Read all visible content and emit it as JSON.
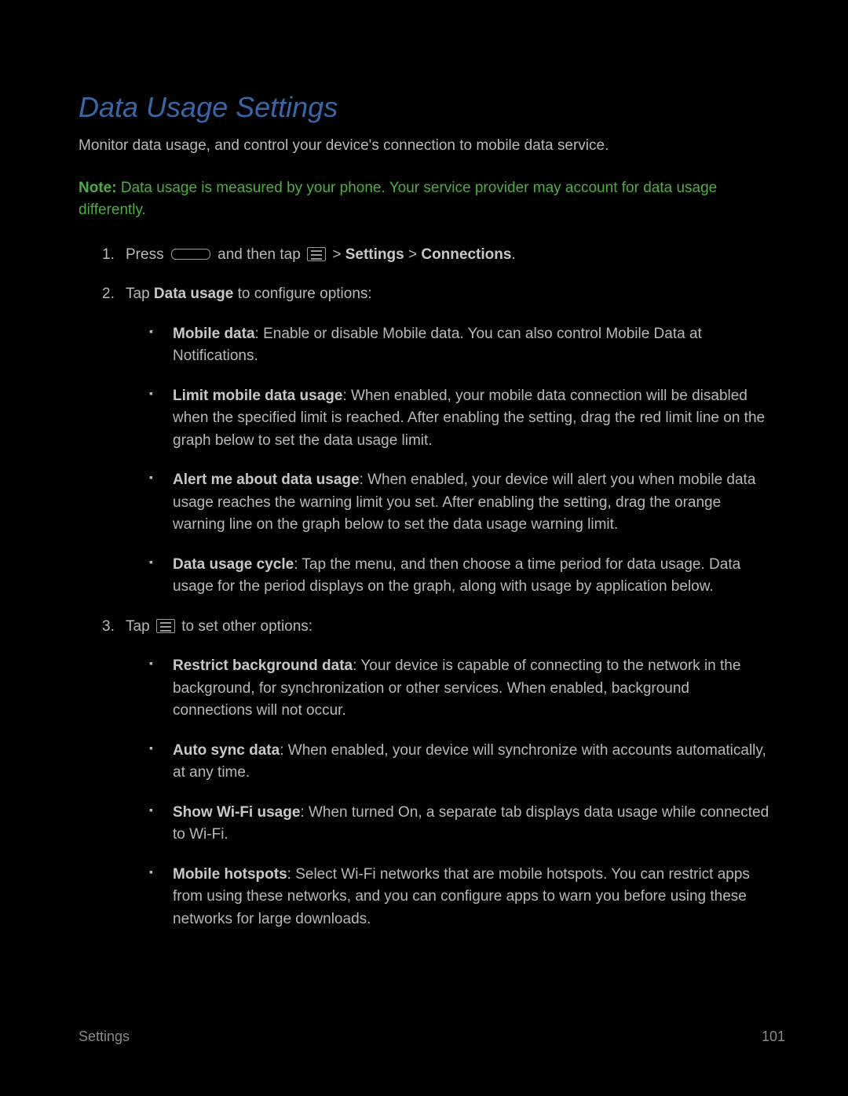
{
  "title": "Data Usage Settings",
  "intro": "Monitor data usage, and control your device's connection to mobile data service.",
  "note_label": "Note:",
  "note_text": " Data usage is measured by your phone. Your service provider may account for data usage differently.",
  "steps": {
    "s1": {
      "before": "Press ",
      "mid": " and then tap ",
      "after1": " > ",
      "bold1": "Settings",
      "sep": " > ",
      "bold2": "Connections",
      "end": "."
    },
    "s2": {
      "before": "Tap ",
      "bold": "Data usage",
      "after": " to configure options:"
    },
    "s3": {
      "before": "Tap ",
      "after": " to set other options:"
    }
  },
  "options1": {
    "b1": {
      "label": "Mobile data",
      "text": ": Enable or disable Mobile data. You can also control Mobile Data at Notifications."
    },
    "b2": {
      "label": "Limit mobile data usage",
      "text": ": When enabled, your mobile data connection will be disabled when the specified limit is reached. After enabling the setting, drag the red limit line on the graph below to set the data usage limit."
    },
    "b3": {
      "label": "Alert me about data usage",
      "text": ": When enabled, your device will alert you when mobile data usage reaches the warning limit you set. After enabling the setting, drag the orange warning line on the graph below to set the data usage warning limit."
    },
    "b4": {
      "label": "Data usage cycle",
      "text": ": Tap the menu, and then choose a time period for data usage. Data usage for the period displays on the graph, along with usage by application below."
    }
  },
  "options2": {
    "b1": {
      "label": "Restrict background data",
      "text": ": Your device is capable of connecting to the network in the background, for synchronization or other services. When enabled, background connections will not occur."
    },
    "b2": {
      "label": "Auto sync data",
      "text": ": When enabled, your device will synchronize with accounts automatically, at any time."
    },
    "b3": {
      "label": "Show Wi-Fi usage",
      "text": ": When turned On, a separate tab displays data usage while connected to Wi-Fi."
    },
    "b4": {
      "label": "Mobile hotspots",
      "text": ": Select Wi-Fi networks that are mobile hotspots. You can restrict apps from using these networks, and you can configure apps to warn you before using these networks for large downloads."
    }
  },
  "footer": {
    "section": "Settings",
    "page": "101"
  }
}
